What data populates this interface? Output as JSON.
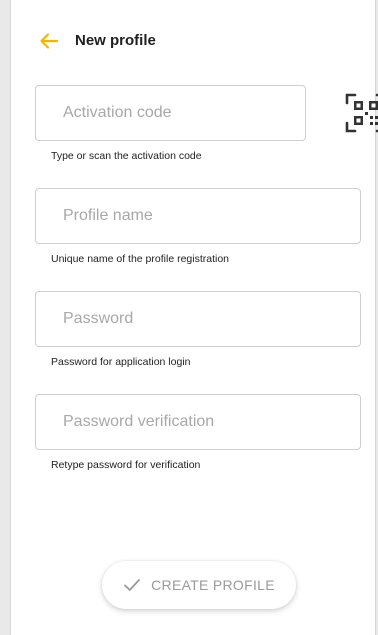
{
  "header": {
    "title": "New profile",
    "back_icon": "arrow-left-icon",
    "accent_color": "#f5b400"
  },
  "form": {
    "activation_code": {
      "value": "",
      "placeholder": "Activation code",
      "hint": "Type or scan the activation code",
      "scan_icon": "qr-code-icon"
    },
    "profile_name": {
      "value": "",
      "placeholder": "Profile name",
      "hint": "Unique name of the profile registration"
    },
    "password": {
      "value": "",
      "placeholder": "Password",
      "hint": "Password for application login"
    },
    "password_verification": {
      "value": "",
      "placeholder": "Password verification",
      "hint": "Retype password for verification"
    }
  },
  "actions": {
    "create_label": "CREATE PROFILE",
    "create_icon": "check-icon"
  }
}
